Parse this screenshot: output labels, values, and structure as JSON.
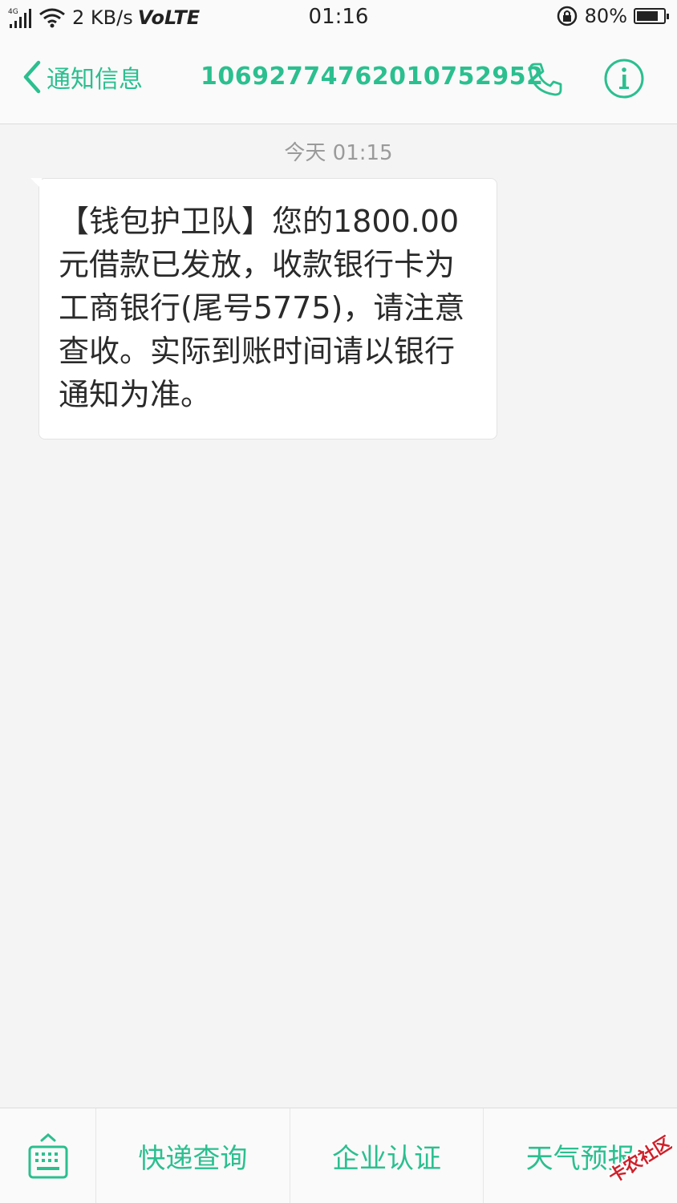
{
  "status_bar": {
    "network": "4G",
    "speed": "2 KB/s",
    "volte": "VoLTE",
    "time": "01:16",
    "battery": "80%",
    "battery_level": 0.8
  },
  "header": {
    "back_label": "通知信息",
    "sender": "10692774762010752952"
  },
  "conversation": {
    "timestamp": "今天 01:15",
    "message": "【钱包护卫队】您的1800.00元借款已发放，收款银行卡为工商银行(尾号5775)，请注意查收。实际到账时间请以银行通知为准。"
  },
  "quick_menu": {
    "items": [
      {
        "label": "快递查询"
      },
      {
        "label": "企业认证"
      },
      {
        "label": "天气预报"
      }
    ]
  },
  "watermark": {
    "text": "卡农社区"
  },
  "colors": {
    "accent": "#2bbf8f",
    "background": "#f4f4f4",
    "bubble": "#ffffff"
  }
}
